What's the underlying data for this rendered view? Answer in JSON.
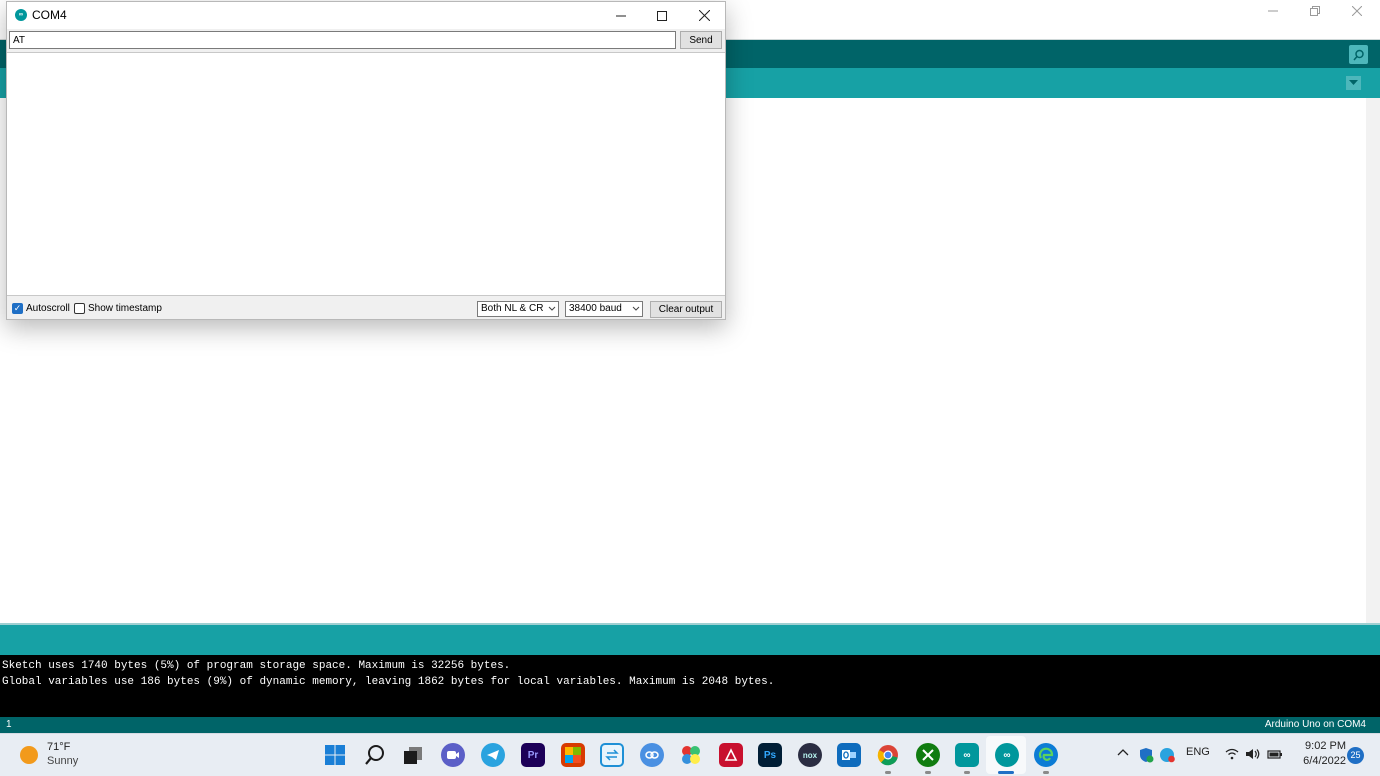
{
  "serial_monitor": {
    "title": "COM4",
    "logo_text": "∞",
    "input_value": "AT",
    "send_label": "Send",
    "autoscroll_label": "Autoscroll",
    "autoscroll_checked": true,
    "timestamp_label": "Show timestamp",
    "timestamp_checked": false,
    "line_ending": "Both NL & CR",
    "baud_rate": "38400 baud",
    "clear_label": "Clear output"
  },
  "ide": {
    "console_lines": [
      "Sketch uses 1740 bytes (5%) of program storage space. Maximum is 32256 bytes.",
      "Global variables use 186 bytes (9%) of dynamic memory, leaving 1862 bytes for local variables. Maximum is 2048 bytes."
    ],
    "status_line": "1",
    "status_board": "Arduino Uno on COM4",
    "colors": {
      "toolbar": "#006468",
      "tabs": "#17a1a5",
      "console": "#000000"
    }
  },
  "taskbar": {
    "weather_temp": "71°F",
    "weather_condition": "Sunny",
    "apps": [
      {
        "name": "start-icon",
        "label": ""
      },
      {
        "name": "search-icon",
        "label": ""
      },
      {
        "name": "task-view-icon",
        "label": ""
      },
      {
        "name": "teams-chat-icon",
        "label": ""
      },
      {
        "name": "telegram-icon",
        "label": ""
      },
      {
        "name": "premiere-pro-icon",
        "label": "Pr"
      },
      {
        "name": "office-icon",
        "label": ""
      },
      {
        "name": "file-transfer-icon",
        "label": ""
      },
      {
        "name": "link-app-icon",
        "label": ""
      },
      {
        "name": "butterfly-app-icon",
        "label": ""
      },
      {
        "name": "acrobat-icon",
        "label": ""
      },
      {
        "name": "photoshop-icon",
        "label": "Ps"
      },
      {
        "name": "nox-icon",
        "label": "nox"
      },
      {
        "name": "outlook-icon",
        "label": ""
      },
      {
        "name": "chrome-icon",
        "label": ""
      },
      {
        "name": "xbox-icon",
        "label": ""
      },
      {
        "name": "arduino-icon",
        "label": "∞"
      },
      {
        "name": "arduino-active-icon",
        "label": "∞"
      },
      {
        "name": "edge-icon",
        "label": ""
      }
    ],
    "tray_language": "ENG",
    "clock_time": "9:02 PM",
    "clock_date": "6/4/2022",
    "notification_count": "25"
  }
}
